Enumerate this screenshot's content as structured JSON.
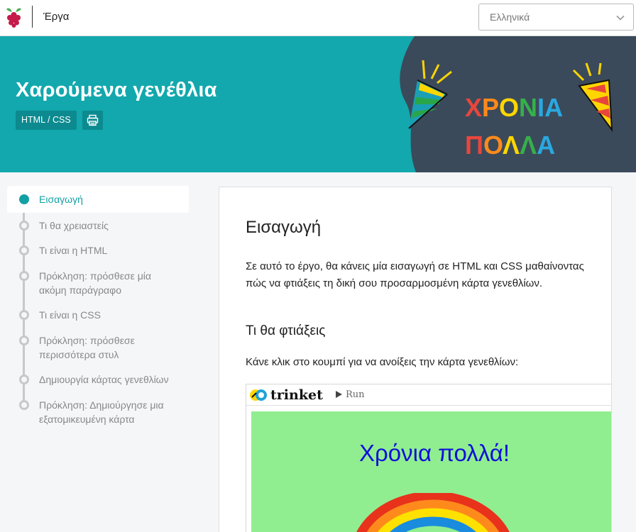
{
  "topbar": {
    "projects_link": "Έργα",
    "language": {
      "selected": "Ελληνικά"
    }
  },
  "hero": {
    "title": "Χαρούμενα γενέθλια",
    "tag": "HTML / CSS",
    "art_text": {
      "line1": "ΧΡΟΝΙΑ",
      "line2": "ΠΟΛΛΑ"
    }
  },
  "sidebar": {
    "steps": [
      {
        "label": "Εισαγωγή",
        "active": true
      },
      {
        "label": "Τι θα χρειαστείς"
      },
      {
        "label": "Τι είναι η HTML"
      },
      {
        "label": "Πρόκληση: πρόσθεσε μία ακόμη παράγραφο"
      },
      {
        "label": "Τι είναι η CSS"
      },
      {
        "label": "Πρόκληση: πρόσθεσε περισσότερα στυλ"
      },
      {
        "label": "Δημιουργία κάρτας γενεθλίων"
      },
      {
        "label": "Πρόκληση: Δημιούργησε μια εξατομικευμένη κάρτα"
      }
    ]
  },
  "content": {
    "heading": "Εισαγωγή",
    "intro": "Σε αυτό το έργο, θα κάνεις μία εισαγωγή σε HTML και CSS μαθαίνοντας πώς να φτιάξεις τη δική σου προσαρμοσμένη κάρτα γενεθλίων.",
    "subheading": "Τι θα φτιάξεις",
    "instruction": "Κάνε κλικ στο κουμπί για να ανοίξεις την κάρτα γενεθλίων:",
    "trinket": {
      "name": "trinket",
      "run_label": "Run",
      "greeting": "Χρόνια πολλά!"
    }
  },
  "colors": {
    "teal": "#12a8ad",
    "dark_slate": "#3b4a5a",
    "card_green": "#90ee90",
    "greeting_blue": "#1010d8"
  }
}
